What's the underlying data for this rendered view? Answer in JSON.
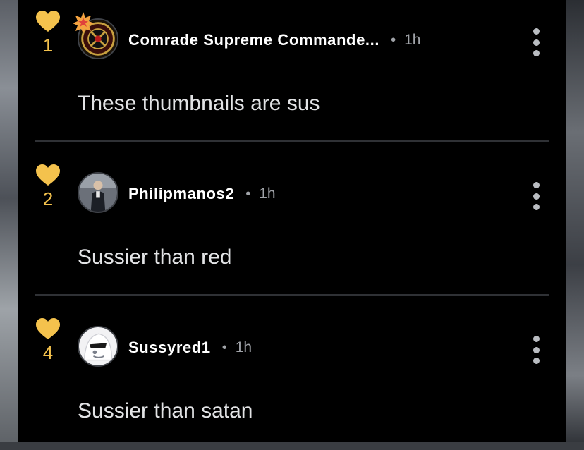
{
  "colors": {
    "heart": "#f4c24d",
    "username": "#ffffff",
    "meta": "#a0a3a8",
    "text": "#e2e3e5",
    "background": "#000000",
    "badge": "#f4a340"
  },
  "comments": [
    {
      "likes": "1",
      "username": "Comrade Supreme Commande...",
      "time": "1h",
      "text": "These thumbnails are sus",
      "has_badge": true,
      "avatar": "military-emblem"
    },
    {
      "likes": "2",
      "username": "Philipmanos2",
      "time": "1h",
      "text": "Sussier than red",
      "has_badge": false,
      "avatar": "standing-person-photo"
    },
    {
      "likes": "4",
      "username": "Sussyred1",
      "time": "1h",
      "text": "Sussier than satan",
      "has_badge": false,
      "avatar": "white-hooded-character"
    }
  ],
  "separator": "•",
  "icons": {
    "like": "heart-icon",
    "menu": "more-vertical-icon",
    "badge": "star-badge-icon"
  }
}
